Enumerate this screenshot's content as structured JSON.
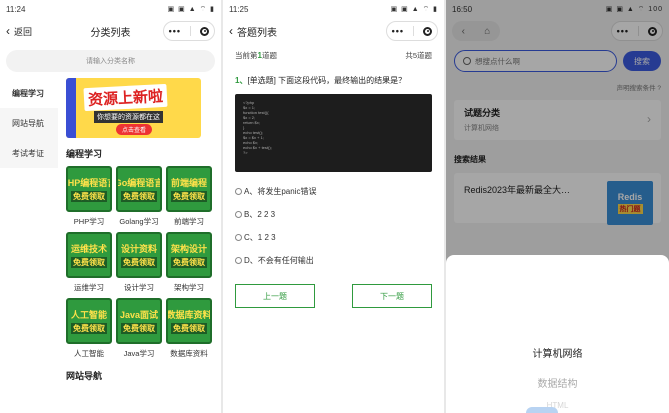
{
  "panel1": {
    "time": "11:24",
    "status_icons": "▣ ▣ ▲ ⌔ ▮",
    "back_label": "返回",
    "title": "分类列表",
    "search_placeholder": "请输入分类名称",
    "sidebar": [
      {
        "label": "编程学习",
        "active": true
      },
      {
        "label": "网站导航",
        "active": false
      },
      {
        "label": "考试考证",
        "active": false
      }
    ],
    "banner": {
      "title": "资源上新啦",
      "subtitle": "你想要的资源都在这",
      "button": "点击查看"
    },
    "section_title": "编程学习",
    "grid": [
      {
        "line1": "PHP编程语言",
        "line2": "免费领取",
        "label": "PHP学习"
      },
      {
        "line1": "Go编程语言",
        "line2": "免费领取",
        "label": "Golang学习"
      },
      {
        "line1": "前端编程",
        "line2": "免费领取",
        "label": "前端学习"
      },
      {
        "line1": "运维技术",
        "line2": "免费领取",
        "label": "运维学习"
      },
      {
        "line1": "设计资料",
        "line2": "免费领取",
        "label": "设计学习"
      },
      {
        "line1": "架构设计",
        "line2": "免费领取",
        "label": "架构学习"
      },
      {
        "line1": "人工智能",
        "line2": "免费领取",
        "label": "人工智能"
      },
      {
        "line1": "Java面试",
        "line2": "免费领取",
        "label": "Java学习"
      },
      {
        "line1": "数据库资料",
        "line2": "免费领取",
        "label": "数据库资料"
      }
    ],
    "section2_title": "网站导航"
  },
  "panel2": {
    "time": "11:25",
    "status_icons": "▣ ▣ ▲ ⌔ ▮",
    "title": "答题列表",
    "current_prefix": "当前第",
    "current_num": "1",
    "current_suffix": "道题",
    "total": "共5道题",
    "question_num": "1、",
    "question_text": "[单选题] 下面这段代码，最终输出的结果是？",
    "code_lines": [
      "<?php",
      "$x = 1;",
      "function test(){",
      "  $x = 2;",
      "  return $x;",
      "}",
      "echo test();",
      "$x = $x + 1;",
      "echo $x;",
      "echo $x + test();",
      "?>"
    ],
    "options": [
      "A、将发生panic错误",
      "B、2 2 3",
      "C、1 2 3",
      "D、不会有任何输出"
    ],
    "prev_label": "上一题",
    "next_label": "下一题"
  },
  "panel3": {
    "time": "16:50",
    "status_icons": "▣ ▣ ▲ ⌔ 100",
    "search_placeholder": "想搜点什么啊",
    "search_button": "搜索",
    "disclaimer": "声明搜索条件 ?",
    "category_title": "试题分类",
    "category_sub": "计算机网络",
    "results_title": "搜索结果",
    "result_title": "Redis2023年最新最全大…",
    "result_img_line1": "Redis",
    "result_img_line2": "热门题",
    "picker_selected": "计算机网络",
    "picker_next": "数据结构",
    "picker_next2": "HTML"
  }
}
